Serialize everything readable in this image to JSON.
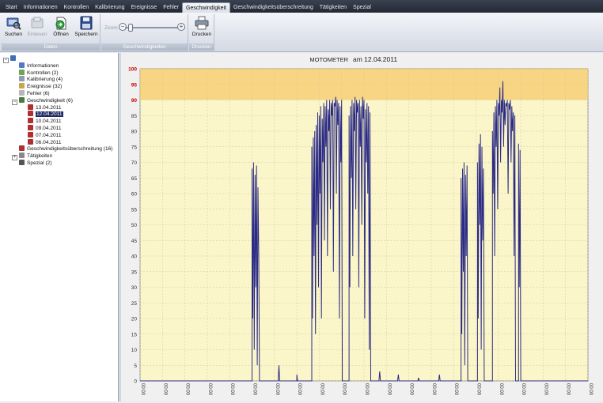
{
  "menu": {
    "tabs": [
      "Start",
      "Informationen",
      "Kontrollen",
      "Kalibrierung",
      "Ereignisse",
      "Fehler",
      "Geschwindigkeit",
      "Geschwindigkeitsüberschreitung",
      "Tätigkeiten",
      "Spezial"
    ],
    "active_index": 6
  },
  "ribbon": {
    "groups": [
      {
        "caption": "Daten",
        "buttons": [
          {
            "label": "Suchen",
            "icon": "search-icon"
          },
          {
            "label": "Einlesen",
            "icon": "import-icon",
            "disabled": true
          },
          {
            "label": "Öffnen",
            "icon": "open-icon"
          },
          {
            "label": "Speichern",
            "icon": "save-icon"
          }
        ]
      },
      {
        "caption": "Geschwindigkeiten",
        "zoom_label": "Zoom"
      },
      {
        "caption": "Drucken",
        "buttons": [
          {
            "label": "Drucken",
            "icon": "printer-icon"
          }
        ]
      }
    ]
  },
  "tree": {
    "items": [
      {
        "label": "",
        "level": 0,
        "expander": "-",
        "icon": "computer-icon",
        "color": "#3f6fb5"
      },
      {
        "label": "Informationen",
        "level": 1,
        "icon": "info-icon",
        "color": "#5577cc"
      },
      {
        "label": "Kontrollen (2)",
        "level": 1,
        "icon": "control-icon",
        "color": "#6aa84f"
      },
      {
        "label": "Kalibrierung (4)",
        "level": 1,
        "icon": "calibration-icon",
        "color": "#8e9bb5"
      },
      {
        "label": "Ereignisse (32)",
        "level": 1,
        "icon": "event-icon",
        "color": "#c9a64a"
      },
      {
        "label": "Fehler (6)",
        "level": 1,
        "icon": "error-icon",
        "color": "#b6b6b6"
      },
      {
        "label": "Geschwindigkeit (6)",
        "level": 1,
        "expander": "-",
        "icon": "speed-icon",
        "color": "#4a7a3d"
      },
      {
        "label": "13.04.2011",
        "level": 2,
        "icon": "chart-doc-icon",
        "color": "#b03030"
      },
      {
        "label": "12.04.2011",
        "level": 2,
        "icon": "chart-doc-icon",
        "color": "#b03030",
        "selected": true
      },
      {
        "label": "10.04.2011",
        "level": 2,
        "icon": "chart-doc-icon",
        "color": "#b03030"
      },
      {
        "label": "09.04.2011",
        "level": 2,
        "icon": "chart-doc-icon",
        "color": "#b03030"
      },
      {
        "label": "07.04.2011",
        "level": 2,
        "icon": "chart-doc-icon",
        "color": "#b03030"
      },
      {
        "label": "06.04.2011",
        "level": 2,
        "icon": "chart-doc-icon",
        "color": "#b03030"
      },
      {
        "label": "Geschwindigkeitsüberschreitung (16)",
        "level": 1,
        "icon": "overspeed-icon",
        "color": "#a33"
      },
      {
        "label": "Tätigkeiten",
        "level": 1,
        "expander": "+",
        "icon": "activity-icon",
        "color": "#888"
      },
      {
        "label": "Spezial (2)",
        "level": 1,
        "icon": "special-icon",
        "color": "#555"
      }
    ]
  },
  "chart_data": {
    "type": "line",
    "title": "MOTOMETER",
    "subtitle": "am 12.04.2011",
    "ylim": [
      0,
      100
    ],
    "yticks": [
      0,
      5,
      10,
      15,
      20,
      25,
      30,
      35,
      40,
      45,
      50,
      55,
      60,
      65,
      70,
      75,
      80,
      85,
      90,
      95,
      100
    ],
    "red_ticks": [
      90,
      95,
      100
    ],
    "band": {
      "from": 90,
      "to": 100,
      "color": "#f5c96a"
    },
    "plot_bg": "#fbf6c9",
    "line_color": "#2b2b86",
    "xtick_labels": [
      "00:00",
      "00:00",
      "00:00",
      "00:00",
      "00:00",
      "00:00",
      "00:00",
      "00:00",
      "00:00",
      "00:00",
      "00:00",
      "00:00",
      "00:00",
      "00:00",
      "00:00",
      "00:00",
      "00:00",
      "00:00",
      "00:00",
      "00:00",
      "00:00"
    ],
    "series": [
      {
        "values": [
          [
            0,
            0
          ],
          [
            150,
            0
          ],
          [
            150,
            68
          ],
          [
            151,
            20
          ],
          [
            152,
            70
          ],
          [
            153,
            10
          ],
          [
            154,
            66
          ],
          [
            155,
            30
          ],
          [
            156,
            69
          ],
          [
            157,
            5
          ],
          [
            158,
            62
          ],
          [
            159,
            40
          ],
          [
            160,
            0
          ],
          [
            185,
            0
          ],
          [
            186,
            5
          ],
          [
            187,
            0
          ],
          [
            210,
            0
          ],
          [
            210,
            2
          ],
          [
            211,
            0
          ],
          [
            230,
            0
          ],
          [
            230,
            75
          ],
          [
            231,
            20
          ],
          [
            232,
            78
          ],
          [
            233,
            40
          ],
          [
            234,
            80
          ],
          [
            235,
            15
          ],
          [
            236,
            82
          ],
          [
            237,
            50
          ],
          [
            238,
            86
          ],
          [
            239,
            30
          ],
          [
            240,
            85
          ],
          [
            241,
            60
          ],
          [
            242,
            88
          ],
          [
            243,
            20
          ],
          [
            244,
            84
          ],
          [
            245,
            70
          ],
          [
            246,
            89
          ],
          [
            247,
            45
          ],
          [
            248,
            88
          ],
          [
            249,
            75
          ],
          [
            250,
            90
          ],
          [
            251,
            40
          ],
          [
            252,
            87
          ],
          [
            253,
            80
          ],
          [
            254,
            90
          ],
          [
            255,
            55
          ],
          [
            256,
            89
          ],
          [
            257,
            85
          ],
          [
            258,
            90
          ],
          [
            259,
            35
          ],
          [
            260,
            89
          ],
          [
            261,
            88
          ],
          [
            262,
            91
          ],
          [
            263,
            60
          ],
          [
            264,
            90
          ],
          [
            265,
            82
          ],
          [
            266,
            89
          ],
          [
            267,
            20
          ],
          [
            268,
            88
          ],
          [
            269,
            70
          ],
          [
            270,
            90
          ],
          [
            271,
            0
          ],
          [
            280,
            0
          ],
          [
            280,
            85
          ],
          [
            281,
            30
          ],
          [
            282,
            88
          ],
          [
            283,
            65
          ],
          [
            284,
            90
          ],
          [
            285,
            40
          ],
          [
            286,
            89
          ],
          [
            287,
            80
          ],
          [
            288,
            91
          ],
          [
            289,
            55
          ],
          [
            290,
            90
          ],
          [
            291,
            86
          ],
          [
            292,
            89
          ],
          [
            293,
            30
          ],
          [
            294,
            90
          ],
          [
            295,
            75
          ],
          [
            296,
            88
          ],
          [
            297,
            50
          ],
          [
            298,
            91
          ],
          [
            299,
            84
          ],
          [
            300,
            90
          ],
          [
            301,
            20
          ],
          [
            302,
            87
          ],
          [
            303,
            70
          ],
          [
            304,
            89
          ],
          [
            305,
            60
          ],
          [
            306,
            88
          ],
          [
            307,
            10
          ],
          [
            308,
            86
          ],
          [
            309,
            0
          ],
          [
            320,
            0
          ],
          [
            321,
            3
          ],
          [
            322,
            0
          ],
          [
            345,
            0
          ],
          [
            346,
            2
          ],
          [
            347,
            0
          ],
          [
            372,
            0
          ],
          [
            373,
            1
          ],
          [
            374,
            0
          ],
          [
            400,
            0
          ],
          [
            401,
            2
          ],
          [
            402,
            0
          ],
          [
            430,
            0
          ],
          [
            430,
            65
          ],
          [
            431,
            15
          ],
          [
            432,
            68
          ],
          [
            433,
            35
          ],
          [
            434,
            70
          ],
          [
            435,
            5
          ],
          [
            436,
            66
          ],
          [
            437,
            40
          ],
          [
            438,
            69
          ],
          [
            439,
            0
          ],
          [
            452,
            0
          ],
          [
            452,
            70
          ],
          [
            453,
            20
          ],
          [
            454,
            76
          ],
          [
            455,
            50
          ],
          [
            456,
            79
          ],
          [
            457,
            10
          ],
          [
            458,
            75
          ],
          [
            459,
            45
          ],
          [
            460,
            68
          ],
          [
            461,
            0
          ],
          [
            472,
            0
          ],
          [
            472,
            80
          ],
          [
            473,
            60
          ],
          [
            474,
            86
          ],
          [
            475,
            40
          ],
          [
            476,
            88
          ],
          [
            477,
            75
          ],
          [
            478,
            90
          ],
          [
            479,
            55
          ],
          [
            480,
            89
          ],
          [
            481,
            85
          ],
          [
            482,
            94
          ],
          [
            483,
            70
          ],
          [
            484,
            90
          ],
          [
            485,
            86
          ],
          [
            486,
            96
          ],
          [
            487,
            75
          ],
          [
            488,
            90
          ],
          [
            489,
            82
          ],
          [
            490,
            89
          ],
          [
            491,
            88
          ],
          [
            492,
            90
          ],
          [
            493,
            60
          ],
          [
            494,
            89
          ],
          [
            495,
            87
          ],
          [
            496,
            90
          ],
          [
            497,
            70
          ],
          [
            498,
            88
          ],
          [
            499,
            80
          ],
          [
            500,
            86
          ],
          [
            501,
            40
          ],
          [
            502,
            85
          ],
          [
            503,
            0
          ],
          [
            507,
            0
          ],
          [
            507,
            76
          ],
          [
            508,
            30
          ],
          [
            509,
            74
          ],
          [
            510,
            0
          ],
          [
            600,
            0
          ]
        ]
      }
    ]
  }
}
